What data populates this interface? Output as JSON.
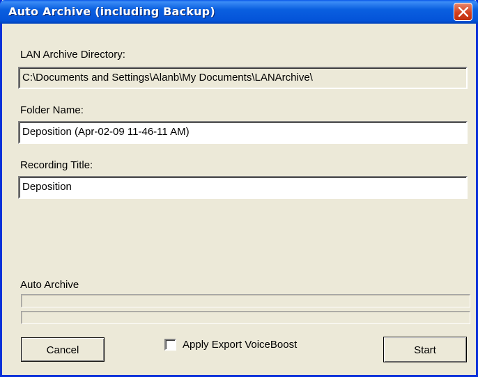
{
  "window": {
    "title": "Auto Archive (including Backup)",
    "close_icon": "close-icon"
  },
  "form": {
    "lan_dir_label": "LAN Archive Directory:",
    "lan_dir_value": "C:\\Documents and Settings\\Alanb\\My Documents\\LANArchive\\",
    "folder_name_label": "Folder Name:",
    "folder_name_value": "Deposition (Apr-02-09 11-46-11 AM)",
    "recording_title_label": "Recording Title:",
    "recording_title_value": "Deposition"
  },
  "progress": {
    "label": "Auto Archive",
    "bar1_value": 0,
    "bar2_value": 0
  },
  "footer": {
    "cancel_label": "Cancel",
    "voiceboost_label": "Apply Export VoiceBoost",
    "voiceboost_checked": false,
    "start_label": "Start"
  },
  "colors": {
    "title_bar": "#0453d8",
    "dialog_face": "#ece9d8",
    "close_button": "#d2401e"
  }
}
